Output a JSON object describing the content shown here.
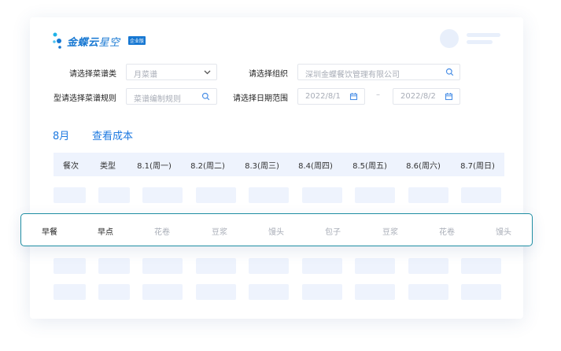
{
  "logo": {
    "name": "金蝶云",
    "accent": "星空",
    "badge": "企业版"
  },
  "filters": {
    "menu_category": {
      "label": "请选择菜谱类",
      "value": "月菜谱"
    },
    "org": {
      "label": "请选择组织",
      "placeholder": "深圳金蝶餐饮管理有限公司"
    },
    "rule": {
      "label": "型请选择菜谱规则",
      "placeholder": "菜谱编制规则"
    },
    "date_range": {
      "label": "请选择日期范围",
      "start": "2022/8/1",
      "separator": "–",
      "end": "2022/8/2"
    }
  },
  "tabs": [
    {
      "label": "8月"
    },
    {
      "label": "查看成本"
    }
  ],
  "table": {
    "headers": [
      "餐次",
      "类型",
      "8.1(周一)",
      "8.2(周二)",
      "8.3(周三)",
      "8.4(周四)",
      "8.5(周五)",
      "8.6(周六)",
      "8.7(周日)"
    ],
    "highlight_row": [
      "早餐",
      "早点",
      "花卷",
      "豆浆",
      "馒头",
      "包子",
      "豆浆",
      "花卷",
      "馒头"
    ]
  },
  "colors": {
    "accent": "#1f7ae0",
    "placeholder_block": "#eef3fd",
    "highlight_border": "#1f8ea3"
  }
}
